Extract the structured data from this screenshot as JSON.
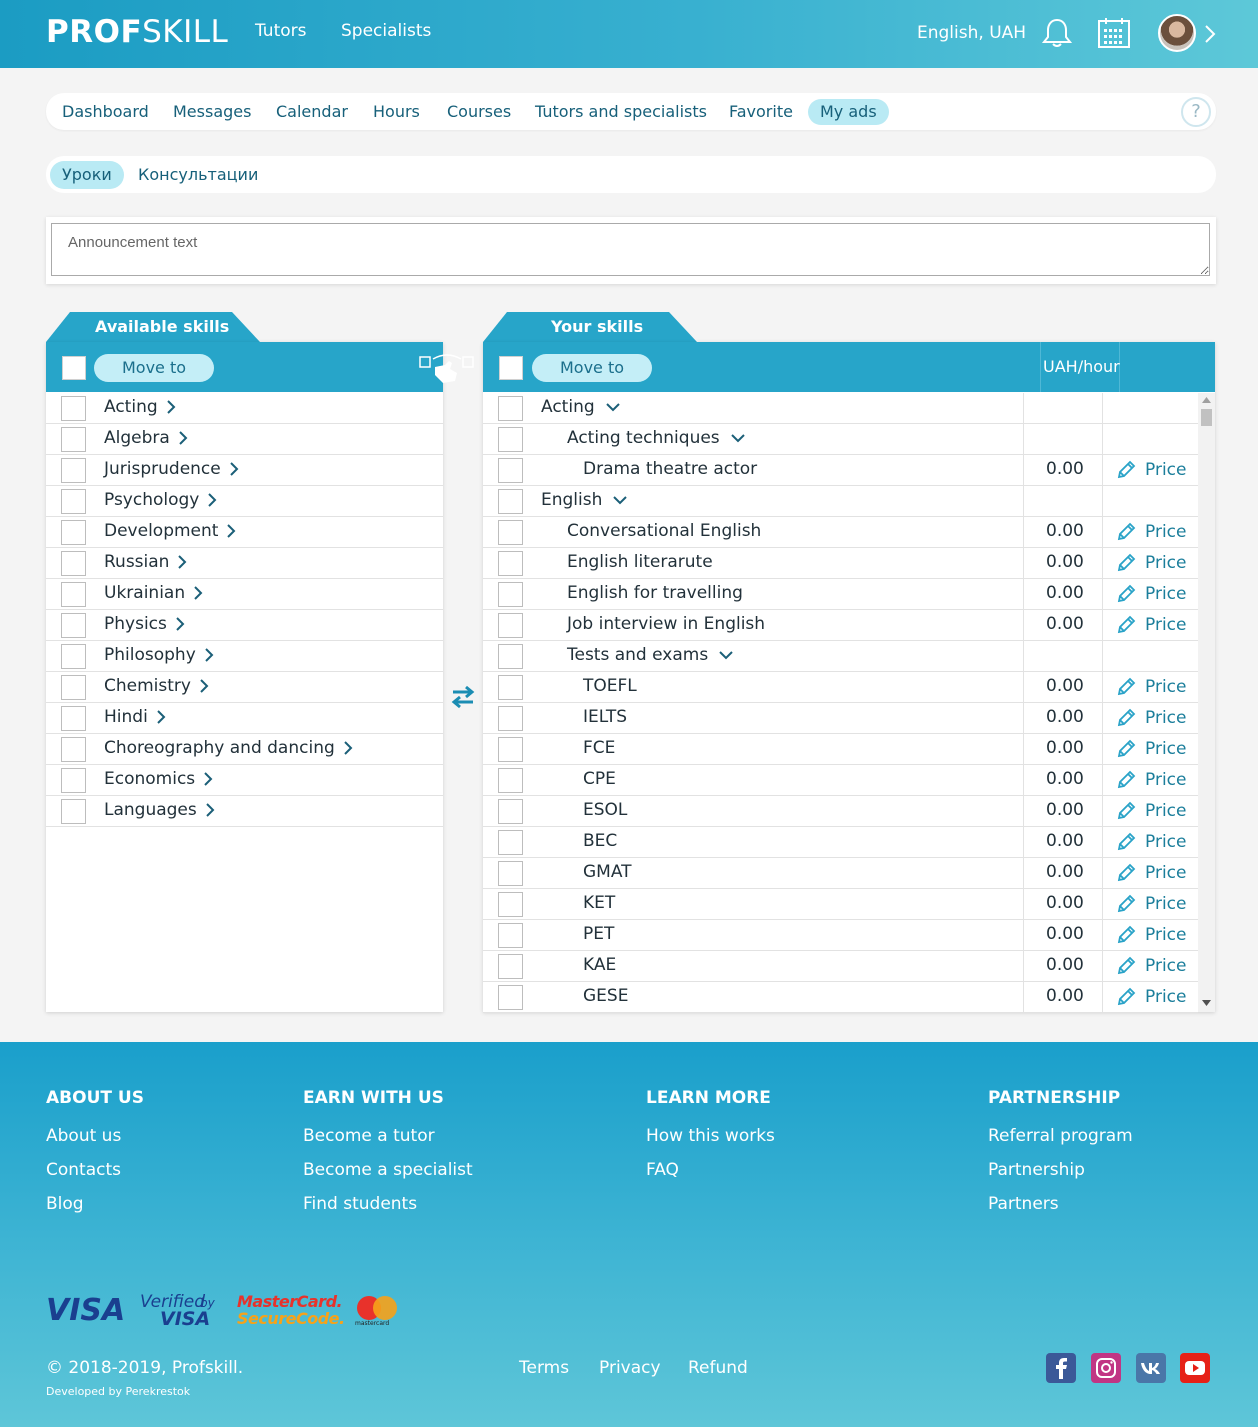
{
  "header": {
    "logo_bold": "PROF",
    "logo_light": "SKILL",
    "nav": [
      "Tutors",
      "Specialists"
    ],
    "locale": "English, UAH",
    "icons": [
      "bell-icon",
      "calendar-icon",
      "avatar",
      "chevron-right-icon"
    ]
  },
  "tabs": [
    "Dashboard",
    "Messages",
    "Calendar",
    "Hours",
    "Courses",
    "Tutors and specialists",
    "Favorite",
    "My ads"
  ],
  "active_tab": "My ads",
  "help_label": "?",
  "subtabs": [
    "Уроки",
    "Консультации"
  ],
  "active_subtab": "Уроки",
  "announcement": {
    "placeholder": "Announcement text",
    "value": ""
  },
  "available": {
    "title": "Available skills",
    "move_label": "Move to",
    "items": [
      "Acting",
      "Algebra",
      "Jurisprudence",
      "Psychology",
      "Development",
      "Russian",
      "Ukrainian",
      "Physics",
      "Philosophy",
      "Chemistry",
      "Hindi",
      "Choreography and dancing",
      "Economics",
      "Languages"
    ]
  },
  "yours": {
    "title": "Your skills",
    "move_label": "Move to",
    "price_header": "UAH/hour",
    "price_action": "Price",
    "rows": [
      {
        "label": "Acting",
        "level": 0,
        "expand": true
      },
      {
        "label": "Acting techniques",
        "level": 1,
        "expand": true
      },
      {
        "label": "Drama theatre actor",
        "level": 2,
        "price": "0.00"
      },
      {
        "label": "English",
        "level": 0,
        "expand": true
      },
      {
        "label": "Conversational English",
        "level": 1,
        "price": "0.00"
      },
      {
        "label": "English literarute",
        "level": 1,
        "price": "0.00"
      },
      {
        "label": "English for travelling",
        "level": 1,
        "price": "0.00"
      },
      {
        "label": "Job interview in English",
        "level": 1,
        "price": "0.00"
      },
      {
        "label": "Tests and exams",
        "level": 1,
        "expand": true
      },
      {
        "label": "TOEFL",
        "level": 2,
        "price": "0.00"
      },
      {
        "label": "IELTS",
        "level": 2,
        "price": "0.00"
      },
      {
        "label": "FCE",
        "level": 2,
        "price": "0.00"
      },
      {
        "label": "CPE",
        "level": 2,
        "price": "0.00"
      },
      {
        "label": "ESOL",
        "level": 2,
        "price": "0.00"
      },
      {
        "label": "BEC",
        "level": 2,
        "price": "0.00"
      },
      {
        "label": "GMAT",
        "level": 2,
        "price": "0.00"
      },
      {
        "label": "KET",
        "level": 2,
        "price": "0.00"
      },
      {
        "label": "PET",
        "level": 2,
        "price": "0.00"
      },
      {
        "label": "KAE",
        "level": 2,
        "price": "0.00"
      },
      {
        "label": "GESE",
        "level": 2,
        "price": "0.00"
      }
    ]
  },
  "footer": {
    "columns": [
      {
        "title": "ABOUT US",
        "links": [
          "About us",
          "Contacts",
          "Blog"
        ]
      },
      {
        "title": "EARN WITH US",
        "links": [
          "Become a tutor",
          "Become a specialist",
          "Find students"
        ]
      },
      {
        "title": "LEARN MORE",
        "links": [
          "How this works",
          "FAQ"
        ]
      },
      {
        "title": "PARTNERSHIP",
        "links": [
          "Referral program",
          "Partnership",
          "Partners"
        ]
      }
    ],
    "payments": {
      "visa": "VISA",
      "verified_top": "Verified",
      "verified_by": "by",
      "verified_visa": "VISA",
      "mc_line1": "MasterCard.",
      "mc_line2": "SecureCode.",
      "mc_small": "mastercard"
    },
    "copyright": "© 2018-2019, Profskill.",
    "developer": "Developed by Perekrestok",
    "legal": [
      "Terms",
      "Privacy",
      "Refund"
    ],
    "social": [
      "facebook-icon",
      "instagram-icon",
      "vk-icon",
      "youtube-icon"
    ],
    "colors": {
      "facebook": "#3b5998",
      "instagram": "#c13584",
      "vk": "#4a76a8",
      "youtube": "#e62117"
    }
  },
  "colors": {
    "accent": "#27a5c9",
    "tab_active": "#b9eaf4",
    "link": "#17607a"
  }
}
